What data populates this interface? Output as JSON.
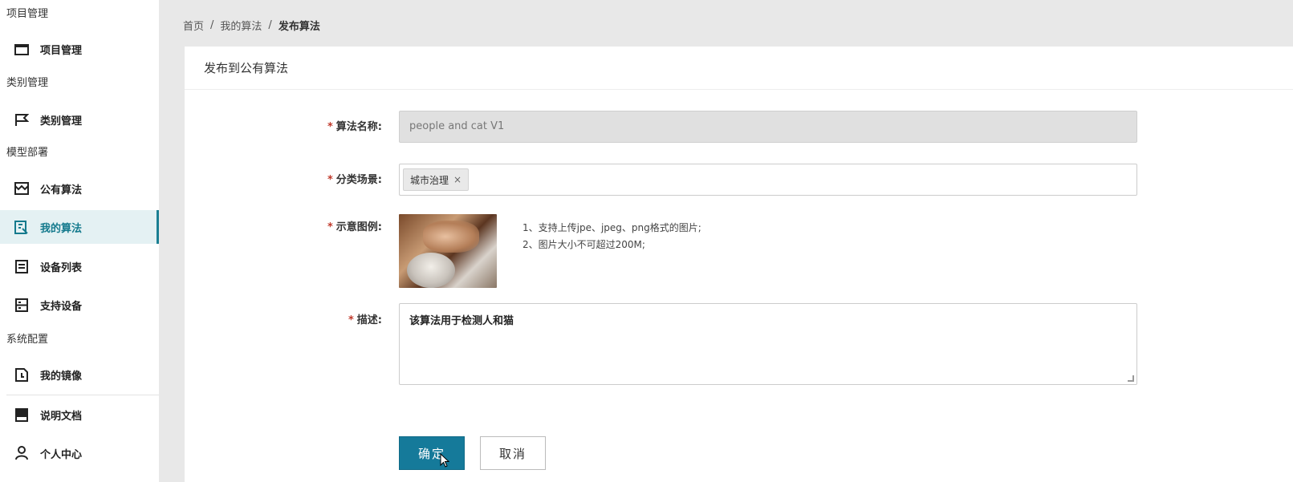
{
  "sidebar": {
    "groups": {
      "project": "项目管理",
      "category": "类别管理",
      "deploy": "模型部署",
      "system": "系统配置"
    },
    "items": [
      {
        "label": "项目管理",
        "icon": "folder-icon"
      },
      {
        "label": "类别管理",
        "icon": "flag-icon"
      },
      {
        "label": "公有算法",
        "icon": "storefront-icon"
      },
      {
        "label": "我的算法",
        "icon": "code-document-icon",
        "active": true
      },
      {
        "label": "设备列表",
        "icon": "list-document-icon"
      },
      {
        "label": "支持设备",
        "icon": "server-icon"
      },
      {
        "label": "我的镜像",
        "icon": "image-file-icon"
      },
      {
        "label": "说明文档",
        "icon": "book-icon"
      },
      {
        "label": "个人中心",
        "icon": "user-icon"
      }
    ]
  },
  "breadcrumb": {
    "home": "首页",
    "sep": "/",
    "parent": "我的算法",
    "current": "发布算法"
  },
  "card": {
    "title": "发布到公有算法"
  },
  "form": {
    "required_mark": "*",
    "name_label": "算法名称:",
    "name_value": "people and cat V1",
    "scene_label": "分类场景:",
    "scene_tag": "城市治理",
    "scene_tag_remove": "×",
    "example_label": "示意图例:",
    "hint_1": "1、支持上传jpe、jpeg、png格式的图片;",
    "hint_2": "2、图片大小不可超过200M;",
    "desc_label": "描述:",
    "desc_value": "该算法用于检测人和猫",
    "ok_button": "确定",
    "cancel_button": "取消"
  },
  "colors": {
    "accent": "#157a9a",
    "active_bg": "#e4f1f3",
    "required": "#c0392b"
  }
}
